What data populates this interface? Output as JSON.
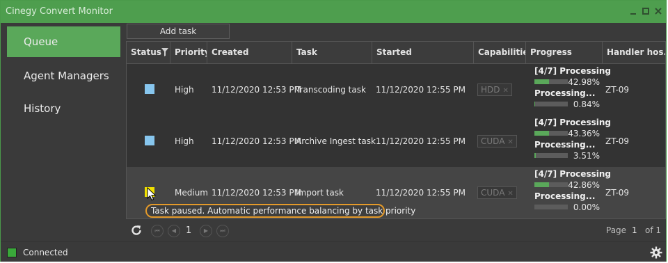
{
  "window": {
    "title": "Cinegy Convert Monitor"
  },
  "sidebar": {
    "items": [
      {
        "label": "Queue",
        "active": true
      },
      {
        "label": "Agent Managers",
        "active": false
      },
      {
        "label": "History",
        "active": false
      }
    ]
  },
  "toolbar": {
    "add_task_label": "Add task"
  },
  "table": {
    "columns": [
      "Status",
      "Priority",
      "Created",
      "Task",
      "Started",
      "Capabilities",
      "Progress",
      "Handler hos..."
    ],
    "rows": [
      {
        "status_color": "#87c6ee",
        "priority": "High",
        "created": "11/12/2020 12:53 PM",
        "task": "Transcoding task",
        "started": "11/12/2020 12:55 PM",
        "capability": "HDD",
        "progress": [
          {
            "label": "[4/7] Processing",
            "percent": "42.98%",
            "value": 0.4298
          },
          {
            "label": "Processing...",
            "percent": "0.84%",
            "value": 0.0084
          }
        ],
        "handler": "ZT-09"
      },
      {
        "status_color": "#87c6ee",
        "priority": "High",
        "created": "11/12/2020 12:53 PM",
        "task": "Archive Ingest task",
        "started": "11/12/2020 12:55 PM",
        "capability": "CUDA",
        "progress": [
          {
            "label": "[4/7] Processing",
            "percent": "43.36%",
            "value": 0.4336
          },
          {
            "label": "Processing...",
            "percent": "3.51%",
            "value": 0.0351
          }
        ],
        "handler": "ZT-09"
      },
      {
        "status_color": "#f0e000",
        "priority": "Medium",
        "created": "11/12/2020 12:53 PM",
        "task": "Import task",
        "started": "11/12/2020 12:55 PM",
        "capability": "CUDA",
        "progress": [
          {
            "label": "[4/7] Processing",
            "percent": "42.86%",
            "value": 0.4286
          },
          {
            "label": "Processing...",
            "percent": "0.00%",
            "value": 0.0
          }
        ],
        "handler": "ZT-09"
      }
    ]
  },
  "tooltip": {
    "text": "Task paused. Automatic performance balancing by task priority"
  },
  "pager": {
    "current_page": "1",
    "page_label": "Page",
    "page_input": "1",
    "of_label": "of 1"
  },
  "statusbar": {
    "connection_label": "Connected",
    "connection_color": "#3aa83a"
  },
  "icons": {
    "minimize": "minimize-icon",
    "maximize": "maximize-icon",
    "close": "close-icon",
    "filter": "filter-icon",
    "refresh": "refresh-icon",
    "settings": "gear-icon"
  }
}
